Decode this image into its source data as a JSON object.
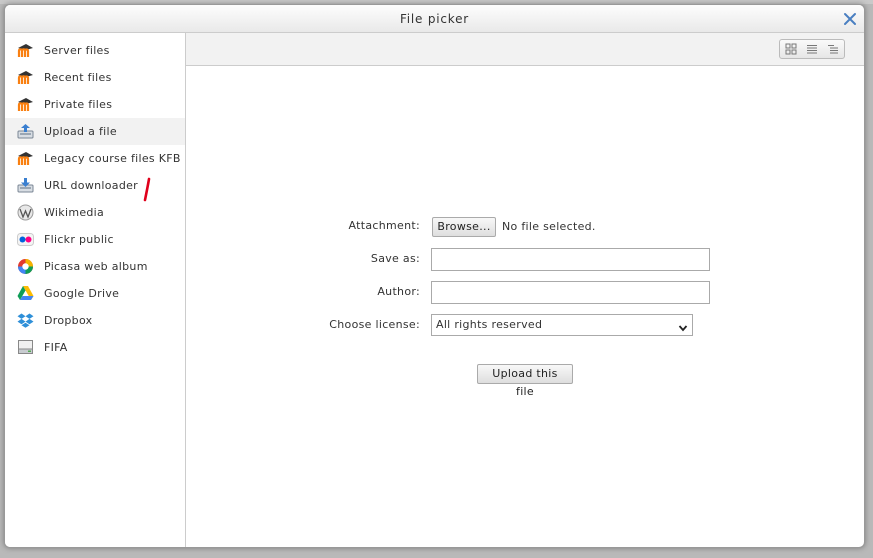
{
  "dialog": {
    "title": "File picker"
  },
  "sidebar": {
    "items": [
      {
        "label": "Server files",
        "icon": "moodle-icon"
      },
      {
        "label": "Recent files",
        "icon": "moodle-icon"
      },
      {
        "label": "Private files",
        "icon": "moodle-icon"
      },
      {
        "label": "Upload a file",
        "icon": "upload-icon",
        "active": true
      },
      {
        "label": "Legacy course files KFB",
        "icon": "moodle-icon"
      },
      {
        "label": "URL downloader",
        "icon": "url-download-icon"
      },
      {
        "label": "Wikimedia",
        "icon": "wikimedia-icon"
      },
      {
        "label": "Flickr public",
        "icon": "flickr-icon"
      },
      {
        "label": "Picasa web album",
        "icon": "picasa-icon"
      },
      {
        "label": "Google Drive",
        "icon": "google-drive-icon"
      },
      {
        "label": "Dropbox",
        "icon": "dropbox-icon"
      },
      {
        "label": "FIFA",
        "icon": "filesystem-icon"
      }
    ]
  },
  "toolbar": {
    "views": [
      "icon-view-icon",
      "list-view-icon",
      "tree-view-icon"
    ]
  },
  "form": {
    "attachment_label": "Attachment:",
    "browse_label": "Browse...",
    "no_file_text": "No file selected.",
    "save_as_label": "Save as:",
    "save_as_value": "",
    "author_label": "Author:",
    "author_value": "",
    "license_label": "Choose license:",
    "license_value": "All rights reserved",
    "upload_label": "Upload this file"
  },
  "colors": {
    "moodle_orange": "#f98012",
    "close_blue": "#4a7fc1",
    "annotation_red": "#e0001b"
  }
}
